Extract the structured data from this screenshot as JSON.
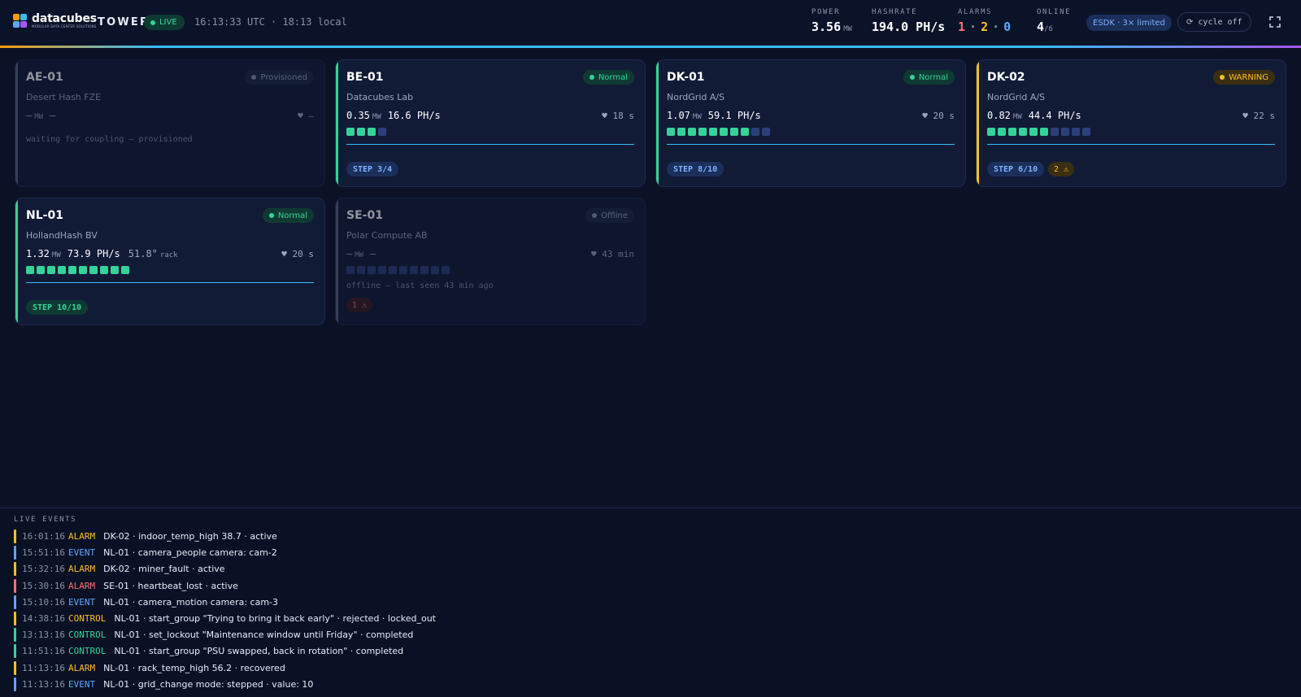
{
  "app": {
    "brand": "datacubes",
    "brand_tag": "MODULAR DATA CENTER SOLUTIONS",
    "name": "TOWER",
    "live_label": "LIVE",
    "clock": "16:13:33 UTC · 18:13 local"
  },
  "stats": {
    "power": {
      "label": "POWER",
      "value": "3.56",
      "unit": "MW"
    },
    "hashrate": {
      "label": "HASHRATE",
      "value": "194.0 PH/s"
    },
    "alarms": {
      "label": "ALARMS",
      "critical": "1",
      "warning": "2",
      "info": "0",
      "sep": "·"
    },
    "online": {
      "label": "ONLINE",
      "value": "4",
      "total": "/6"
    }
  },
  "esdk_label": "ESDK · 3× limited",
  "cycle_label": "⟳ cycle off",
  "icons": {
    "fullscreen": "fullscreen-icon",
    "heart": "heart-icon",
    "refresh": "refresh-icon"
  },
  "colors": {
    "ok": "#34d399",
    "warn": "#fbbf24",
    "crit": "#f87171",
    "info": "#60a5fa",
    "accent": "#38bdf8"
  },
  "sites": [
    {
      "name": "AE-01",
      "status": "Provisioned",
      "owner": "Desert Hash FZE",
      "mw": "—",
      "mw_unit": "MW",
      "hash": "—",
      "heartbeat": "♥ —",
      "note": "waiting for coupling — provisioned"
    },
    {
      "name": "BE-01",
      "status": "Normal",
      "owner": "Datacubes Lab",
      "mw": "0.35",
      "mw_unit": "MW",
      "hash": "16.6 PH/s",
      "heartbeat": "♥ 18 s",
      "step": "STEP 3/4",
      "units_on": 3,
      "units_total": 4
    },
    {
      "name": "DK-01",
      "status": "Normal",
      "owner": "NordGrid A/S",
      "mw": "1.07",
      "mw_unit": "MW",
      "hash": "59.1 PH/s",
      "heartbeat": "♥ 20 s",
      "step": "STEP 8/10",
      "units_on": 8,
      "units_total": 10
    },
    {
      "name": "DK-02",
      "status": "WARNING",
      "owner": "NordGrid A/S",
      "mw": "0.82",
      "mw_unit": "MW",
      "hash": "44.4 PH/s",
      "heartbeat": "♥ 22 s",
      "step": "STEP 6/10",
      "alarm_chip": "2 ⚠",
      "units_on": 6,
      "units_total": 10
    },
    {
      "name": "NL-01",
      "status": "Normal",
      "owner": "HollandHash BV",
      "mw": "1.32",
      "mw_unit": "MW",
      "hash": "73.9 PH/s",
      "temp": "51.8°",
      "temp_unit": "rack",
      "heartbeat": "♥ 20 s",
      "step": "STEP 10/10",
      "units_on": 10,
      "units_total": 10
    },
    {
      "name": "SE-01",
      "status": "Offline",
      "owner": "Polar Compute AB",
      "mw": "—",
      "mw_unit": "MW",
      "hash": "—",
      "heartbeat": "♥ 43 min",
      "note": "offline — last seen 43 min ago",
      "alarm_chip": "1 ⚠",
      "units_on": 0,
      "units_total": 10
    }
  ],
  "events": {
    "title": "LIVE EVENTS",
    "rows": [
      {
        "time": "16:01:16",
        "type": "ALARM",
        "msg": "DK-02 · indoor_temp_high 38.7 · active",
        "color": "#fbbf24",
        "stripe": "#fbbf24"
      },
      {
        "time": "15:51:16",
        "type": "EVENT",
        "msg": "NL-01 · camera_people camera: cam-2",
        "color": "#60a5fa",
        "stripe": "#60a5fa"
      },
      {
        "time": "15:32:16",
        "type": "ALARM",
        "msg": "DK-02 · miner_fault · active",
        "color": "#fbbf24",
        "stripe": "#fbbf24"
      },
      {
        "time": "15:30:16",
        "type": "ALARM",
        "msg": "SE-01 · heartbeat_lost · active",
        "color": "#f87171",
        "stripe": "#f87171"
      },
      {
        "time": "15:10:16",
        "type": "EVENT",
        "msg": "NL-01 · camera_motion camera: cam-3",
        "color": "#60a5fa",
        "stripe": "#60a5fa"
      },
      {
        "time": "14:38:16",
        "type": "CONTROL",
        "msg": "NL-01 · start_group \"Trying to bring it back early\" · rejected · locked_out",
        "color": "#fbbf24",
        "stripe": "#fbbf24"
      },
      {
        "time": "13:13:16",
        "type": "CONTROL",
        "msg": "NL-01 · set_lockout \"Maintenance window until Friday\" · completed",
        "color": "#34d399",
        "stripe": "#34d399"
      },
      {
        "time": "11:51:16",
        "type": "CONTROL",
        "msg": "NL-01 · start_group \"PSU swapped, back in rotation\" · completed",
        "color": "#34d399",
        "stripe": "#34d399"
      },
      {
        "time": "11:13:16",
        "type": "ALARM",
        "msg": "NL-01 · rack_temp_high 56.2 · recovered",
        "color": "#fbbf24",
        "stripe": "#fbbf24"
      },
      {
        "time": "11:13:16",
        "type": "EVENT",
        "msg": "NL-01 · grid_change mode: stepped · value: 10",
        "color": "#60a5fa",
        "stripe": "#60a5fa"
      }
    ]
  }
}
